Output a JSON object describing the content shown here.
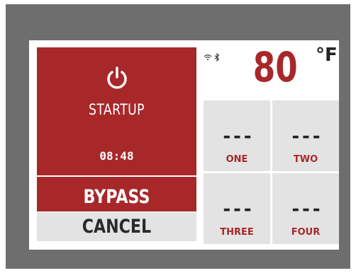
{
  "device": {
    "mode_label": "STARTUP",
    "timer": "08:48",
    "bypass_label": "BYPASS",
    "cancel_label": "CANCEL",
    "power_icon": "power-icon"
  },
  "status": {
    "wifi_icon": "wifi-icon",
    "bluetooth_icon": "bluetooth-icon"
  },
  "temperature": {
    "value": "80",
    "unit": "°F"
  },
  "zones": [
    {
      "value": "---",
      "name": "ONE"
    },
    {
      "value": "---",
      "name": "TWO"
    },
    {
      "value": "---",
      "name": "THREE"
    },
    {
      "value": "---",
      "name": "FOUR"
    }
  ],
  "colors": {
    "accent_red": "#a8282a",
    "tile_gray": "#e3e3e3",
    "bezel": "#6e6e6e"
  }
}
